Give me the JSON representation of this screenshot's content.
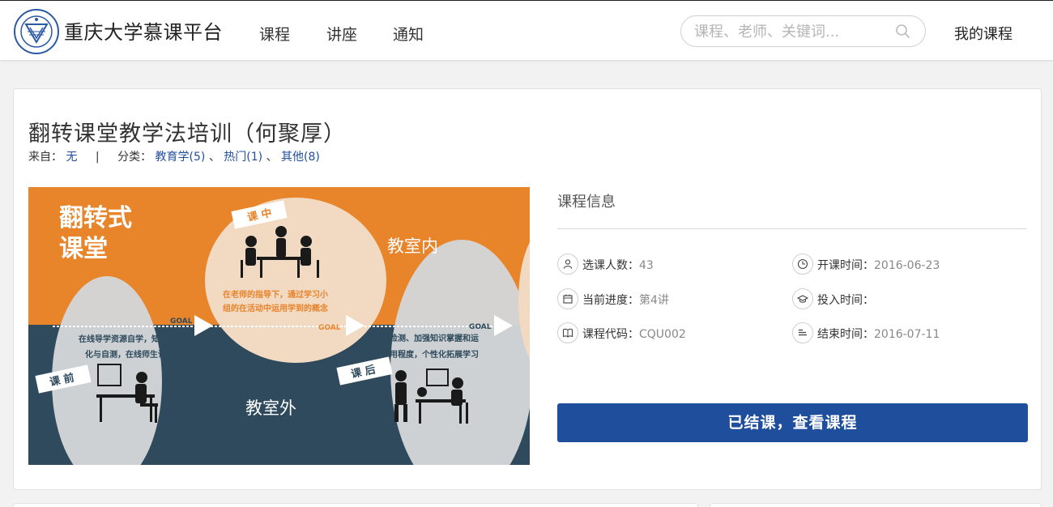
{
  "header": {
    "site_title": "重庆大学慕课平台",
    "nav": [
      "课程",
      "讲座",
      "通知"
    ],
    "search_placeholder": "课程、老师、关键词...",
    "my_courses": "我的课程"
  },
  "course": {
    "title": "翻转课堂教学法培训（何聚厚）",
    "from_label": "来自：",
    "from_value": "无",
    "separator": "|",
    "category_label": "分类：",
    "categories": [
      "教育学(5)",
      "热门(1)",
      "其他(8)"
    ],
    "category_delimiter": "、"
  },
  "banner": {
    "heading_line1": "翻转式",
    "heading_line2": "课堂",
    "tag_during": "课 中",
    "tag_before": "课 前",
    "tag_after": "课 后",
    "classroom_inside": "教室内",
    "classroom_outside": "教室外",
    "goal": "GOAL",
    "middle_text_line1": "在老师的指导下，通过学习小",
    "middle_text_line2": "组的在活动中运用学到的概念",
    "left_text_line1": "在线导学资源自学，知识内",
    "left_text_line2": "化与自测，在线师生讨论",
    "right_text_line1": "检测、加强知识掌握和运",
    "right_text_line2": "用程度，个性化拓展学习",
    "colors": {
      "orange": "#e8842a",
      "navy": "#2e4a5c",
      "oval": "#d4d6d8"
    }
  },
  "info": {
    "title": "课程信息",
    "items": [
      {
        "icon": "person-icon",
        "label": "选课人数：",
        "value": "43"
      },
      {
        "icon": "clock-icon",
        "label": "开课时间：",
        "value": "2016-06-23"
      },
      {
        "icon": "calendar-icon",
        "label": "当前进度：",
        "value": "第4讲"
      },
      {
        "icon": "graduation-cap-icon",
        "label": "投入时间：",
        "value": ""
      },
      {
        "icon": "book-icon",
        "label": "课程代码：",
        "value": "CQU002"
      },
      {
        "icon": "list-icon",
        "label": "结束时间：",
        "value": "2016-07-11"
      }
    ],
    "button": "已结课，查看课程"
  },
  "colors": {
    "accent": "#1f4e9c",
    "link": "#1f4e9c"
  }
}
